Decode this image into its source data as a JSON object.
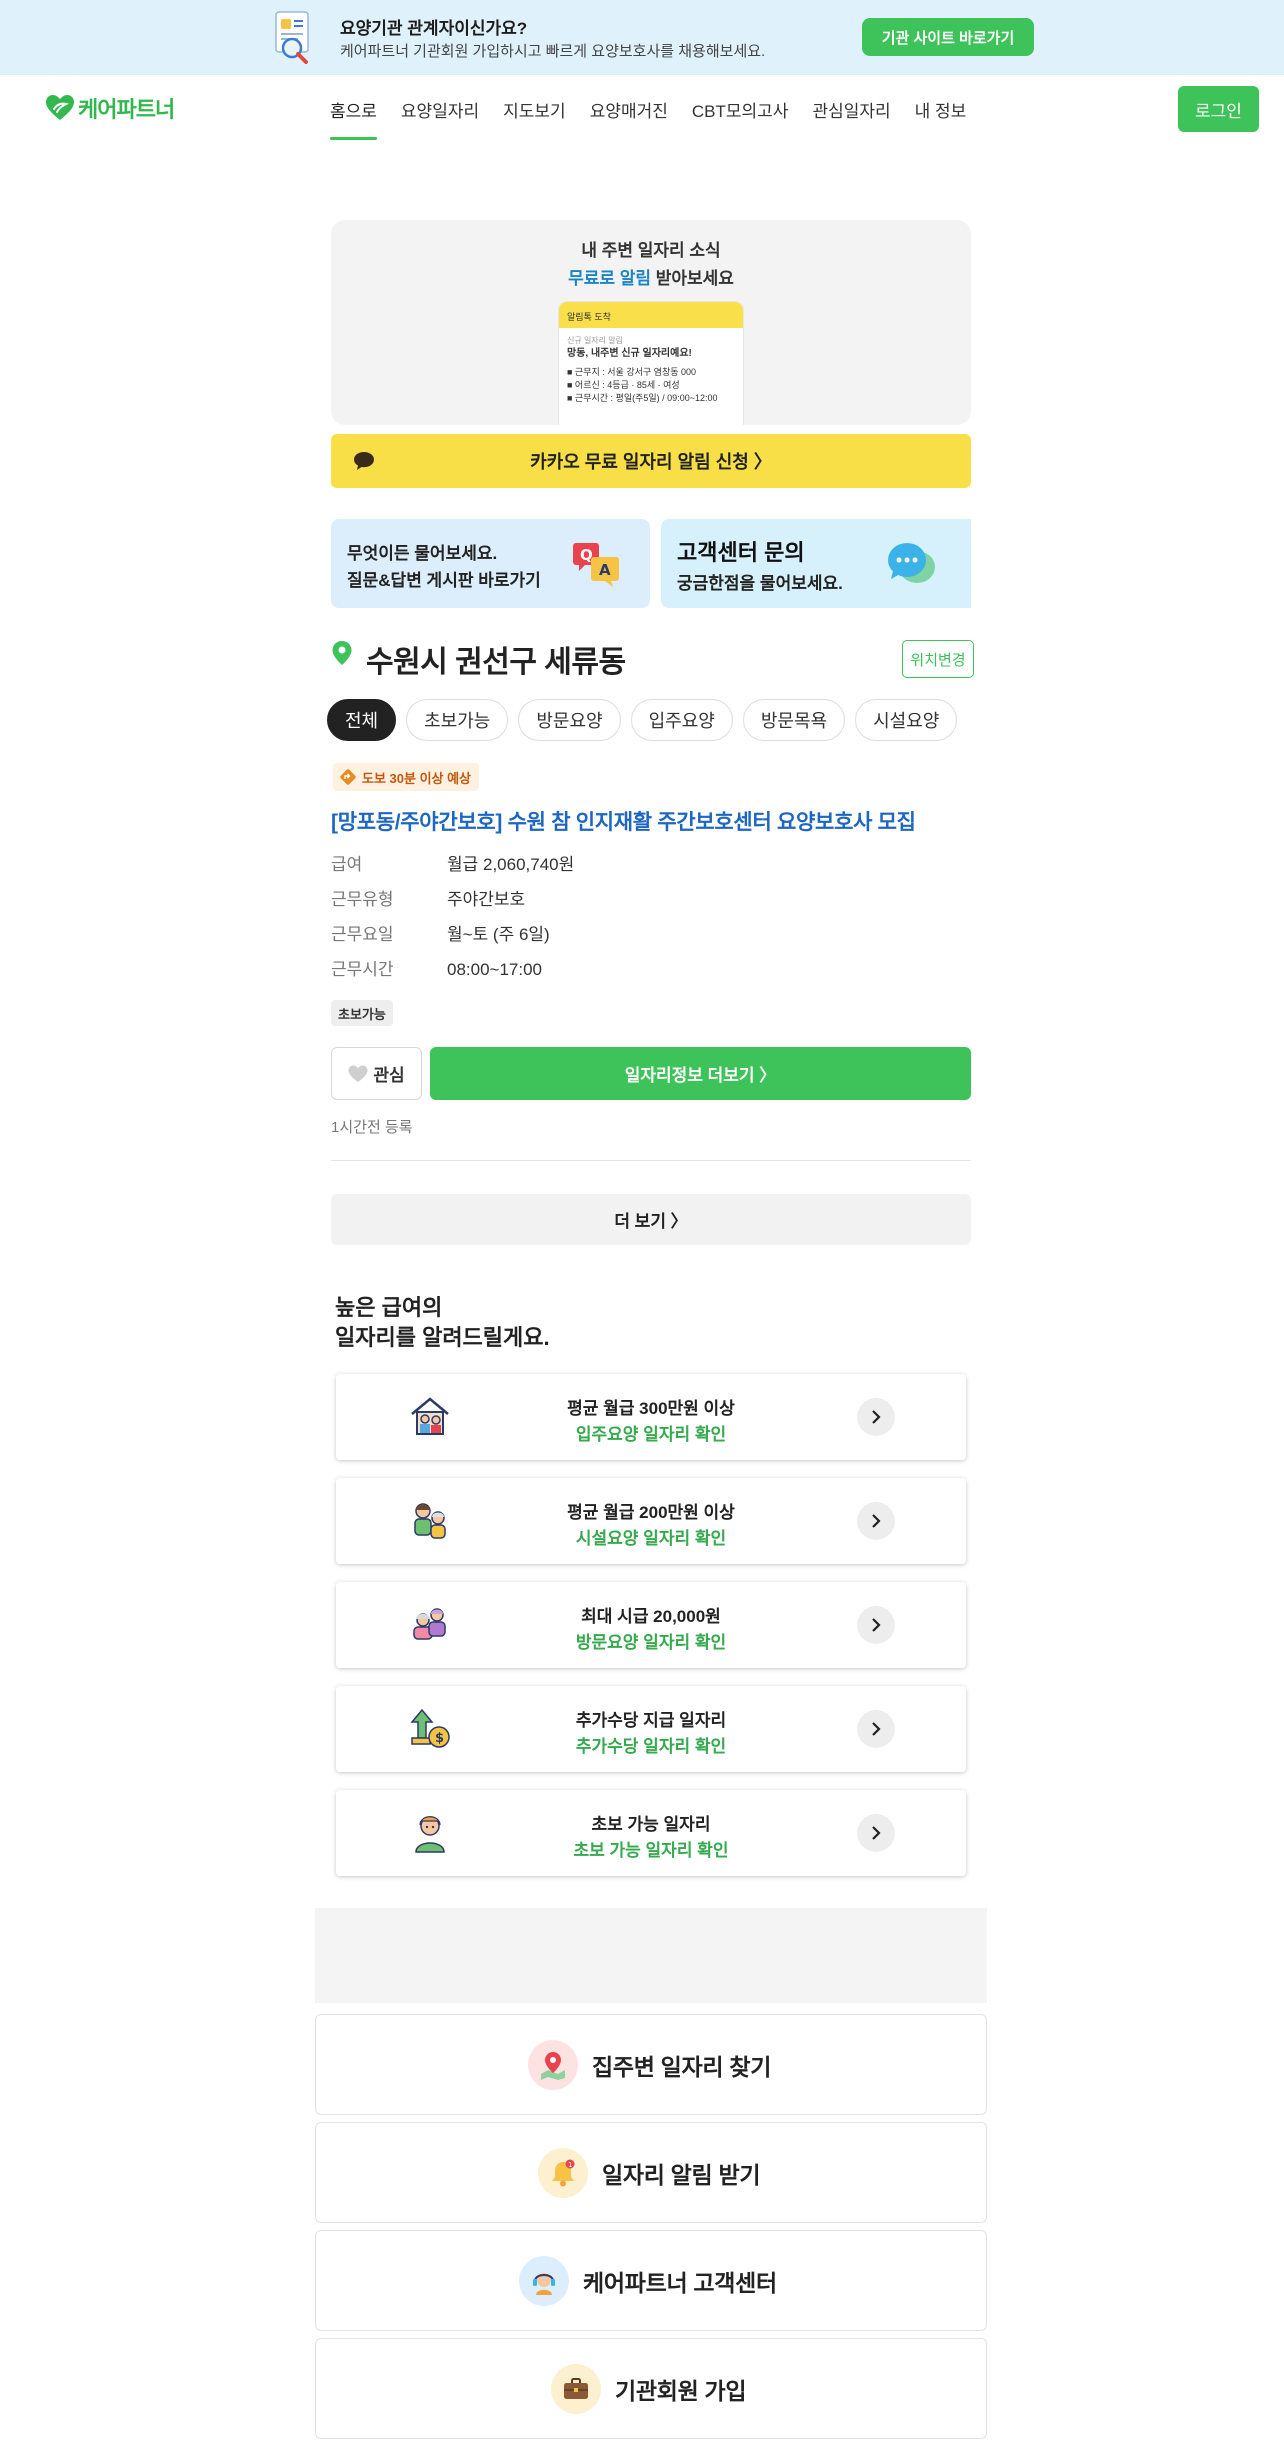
{
  "top_banner": {
    "title": "요양기관 관계자이신가요?",
    "subtitle": "케어파트너 기관회원 가입하시고 빠르게 요양보호사를 채용해보세요.",
    "button": "기관 사이트 바로가기"
  },
  "header": {
    "logo": "케어파트너",
    "nav": [
      "홈으로",
      "요양일자리",
      "지도보기",
      "요양매거진",
      "CBT모의고사",
      "관심일자리",
      "내 정보"
    ],
    "active_nav": "홈으로",
    "login": "로그인"
  },
  "promo": {
    "line1": "내 주변 일자리 소식",
    "line2_highlight": "무료로 알림",
    "line2_rest": " 받아보세요",
    "phone_header": "알림톡 도착",
    "phone_caption": "신규 일자리 알림",
    "phone_title": "망동, 내주변 신규 일자리예요!",
    "phone_lines": [
      "■ 근무지 : 서울 강서구 염창동 000",
      "■ 어르신 : 4등급 · 85세 · 여성",
      "■ 근무시간 : 평일(주5일) / 09:00~12:00"
    ],
    "kakao_button": "카카오 무료 일자리 알림 신청 〉"
  },
  "cards": {
    "qa_line1": "무엇이든 물어보세요.",
    "qa_line2": "질문&답변 게시판 바로가기",
    "cs_line1": "고객센터 문의",
    "cs_line2": "궁금한점을 물어보세요."
  },
  "location": {
    "title": "수원시 권선구 세류동",
    "change": "위치변경"
  },
  "filters": [
    "전체",
    "초보가능",
    "방문요양",
    "입주요양",
    "방문목욕",
    "시설요양"
  ],
  "active_filter": "전체",
  "job": {
    "walk_badge": "도보 30분 이상 예상",
    "title": "[망포동/주야간보호] 수원 참 인지재활 주간보호센터 요양보호사 모집",
    "rows": [
      {
        "k": "급여",
        "v": "월급 2,060,740원"
      },
      {
        "k": "근무유형",
        "v": "주야간보호"
      },
      {
        "k": "근무요일",
        "v": "월~토 (주 6일)"
      },
      {
        "k": "근무시간",
        "v": "08:00~17:00"
      }
    ],
    "tag": "초보가능",
    "like": "관심",
    "more_info": "일자리정보 더보기 〉",
    "posted": "1시간전 등록"
  },
  "see_more": "더 보기 〉",
  "high_wage": {
    "title_line1": "높은 급여의",
    "title_line2": "일자리를 알려드릴게요.",
    "items": [
      {
        "l1": "평균 월급 300만원 이상",
        "l2": "입주요양 일자리 확인",
        "icon": "house-caregiver-icon"
      },
      {
        "l1": "평균 월급 200만원 이상",
        "l2": "시설요양 일자리 확인",
        "icon": "caregiver-pair-icon"
      },
      {
        "l1": "최대 시급 20,000원",
        "l2": "방문요양 일자리 확인",
        "icon": "elderly-couple-icon"
      },
      {
        "l1": "추가수당 지급 일자리",
        "l2": "추가수당 일자리 확인",
        "icon": "money-up-icon"
      },
      {
        "l1": "초보 가능 일자리",
        "l2": "초보 가능 일자리 확인",
        "icon": "beginner-worker-icon"
      }
    ]
  },
  "bottom_links": [
    {
      "label": "집주변 일자리 찾기",
      "icon": "map-pin-icon"
    },
    {
      "label": "일자리 알림 받기",
      "icon": "bell-icon"
    },
    {
      "label": "케어파트너 고객센터",
      "icon": "headset-icon"
    },
    {
      "label": "기관회원 가입",
      "icon": "briefcase-icon"
    }
  ],
  "colors": {
    "brand_green": "#3ec25a",
    "kakao_yellow": "#f8df47",
    "link_blue": "#1d66c2",
    "banner_bg": "#dff1fb"
  }
}
